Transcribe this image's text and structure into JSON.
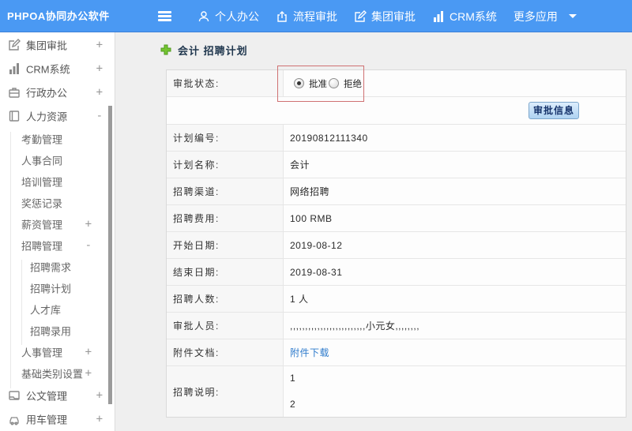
{
  "colors": {
    "topbar": "#4a99f3",
    "annotation": "#d06868",
    "link": "#2e7bcc"
  },
  "topbar": {
    "logo": "PHPOA协同办公软件",
    "menu": [
      {
        "icon": "person-icon",
        "label": "个人办公"
      },
      {
        "icon": "flow-approval-icon",
        "label": "流程审批"
      },
      {
        "icon": "edit-square-icon",
        "label": "集团审批"
      },
      {
        "icon": "bar-chart-icon",
        "label": "CRM系统"
      },
      {
        "icon": "",
        "label": "更多应用",
        "caret": true
      }
    ]
  },
  "sidebar": {
    "items": [
      {
        "label": "集团审批",
        "icon": "edit-square-icon",
        "toggle": "+",
        "level": 1
      },
      {
        "label": "CRM系统",
        "icon": "bar-chart-icon",
        "toggle": "+",
        "level": 1
      },
      {
        "label": "行政办公",
        "icon": "briefcase-icon",
        "toggle": "+",
        "level": 1
      },
      {
        "label": "人力资源",
        "icon": "book-icon",
        "toggle": "-",
        "level": 1
      },
      {
        "label": "考勤管理",
        "level": 2
      },
      {
        "label": "人事合同",
        "level": 2
      },
      {
        "label": "培训管理",
        "level": 2
      },
      {
        "label": "奖惩记录",
        "level": 2
      },
      {
        "label": "薪资管理",
        "toggle": "+",
        "level": 2
      },
      {
        "label": "招聘管理",
        "toggle": "-",
        "level": 2
      },
      {
        "label": "招聘需求",
        "level": 3
      },
      {
        "label": "招聘计划",
        "level": 3
      },
      {
        "label": "人才库",
        "level": 3
      },
      {
        "label": "招聘录用",
        "level": 3
      },
      {
        "label": "人事管理",
        "toggle": "+",
        "level": 2
      },
      {
        "label": "基础类别设置",
        "toggle": "+",
        "level": 2
      },
      {
        "label": "公文管理",
        "icon": "document-icon",
        "toggle": "+",
        "level": 1
      },
      {
        "label": "用车管理",
        "icon": "car-icon",
        "toggle": "+",
        "level": 1
      }
    ]
  },
  "main": {
    "title": "会计 招聘计划",
    "form": {
      "status_label": "审批状态:",
      "status_options": [
        {
          "label": "批准",
          "selected": true
        },
        {
          "label": "拒绝",
          "selected": false
        }
      ],
      "approve_button": "审批信息",
      "rows": [
        {
          "label": "计划编号:",
          "value": "20190812111340"
        },
        {
          "label": "计划名称:",
          "value": "会计"
        },
        {
          "label": "招聘渠道:",
          "value": "网络招聘"
        },
        {
          "label": "招聘费用:",
          "value": "100 RMB"
        },
        {
          "label": "开始日期:",
          "value": "2019-08-12"
        },
        {
          "label": "结束日期:",
          "value": "2019-08-31"
        },
        {
          "label": "招聘人数:",
          "value": "1 人"
        },
        {
          "label": "审批人员:",
          "value": ",,,,,,,,,,,,,,,,,,,,,,,,,小元女,,,,,,,,"
        },
        {
          "label": "附件文档:",
          "value": "附件下载",
          "link": true
        }
      ],
      "description_row": {
        "label": "招聘说明:",
        "lines": [
          "1",
          "2"
        ]
      }
    }
  }
}
